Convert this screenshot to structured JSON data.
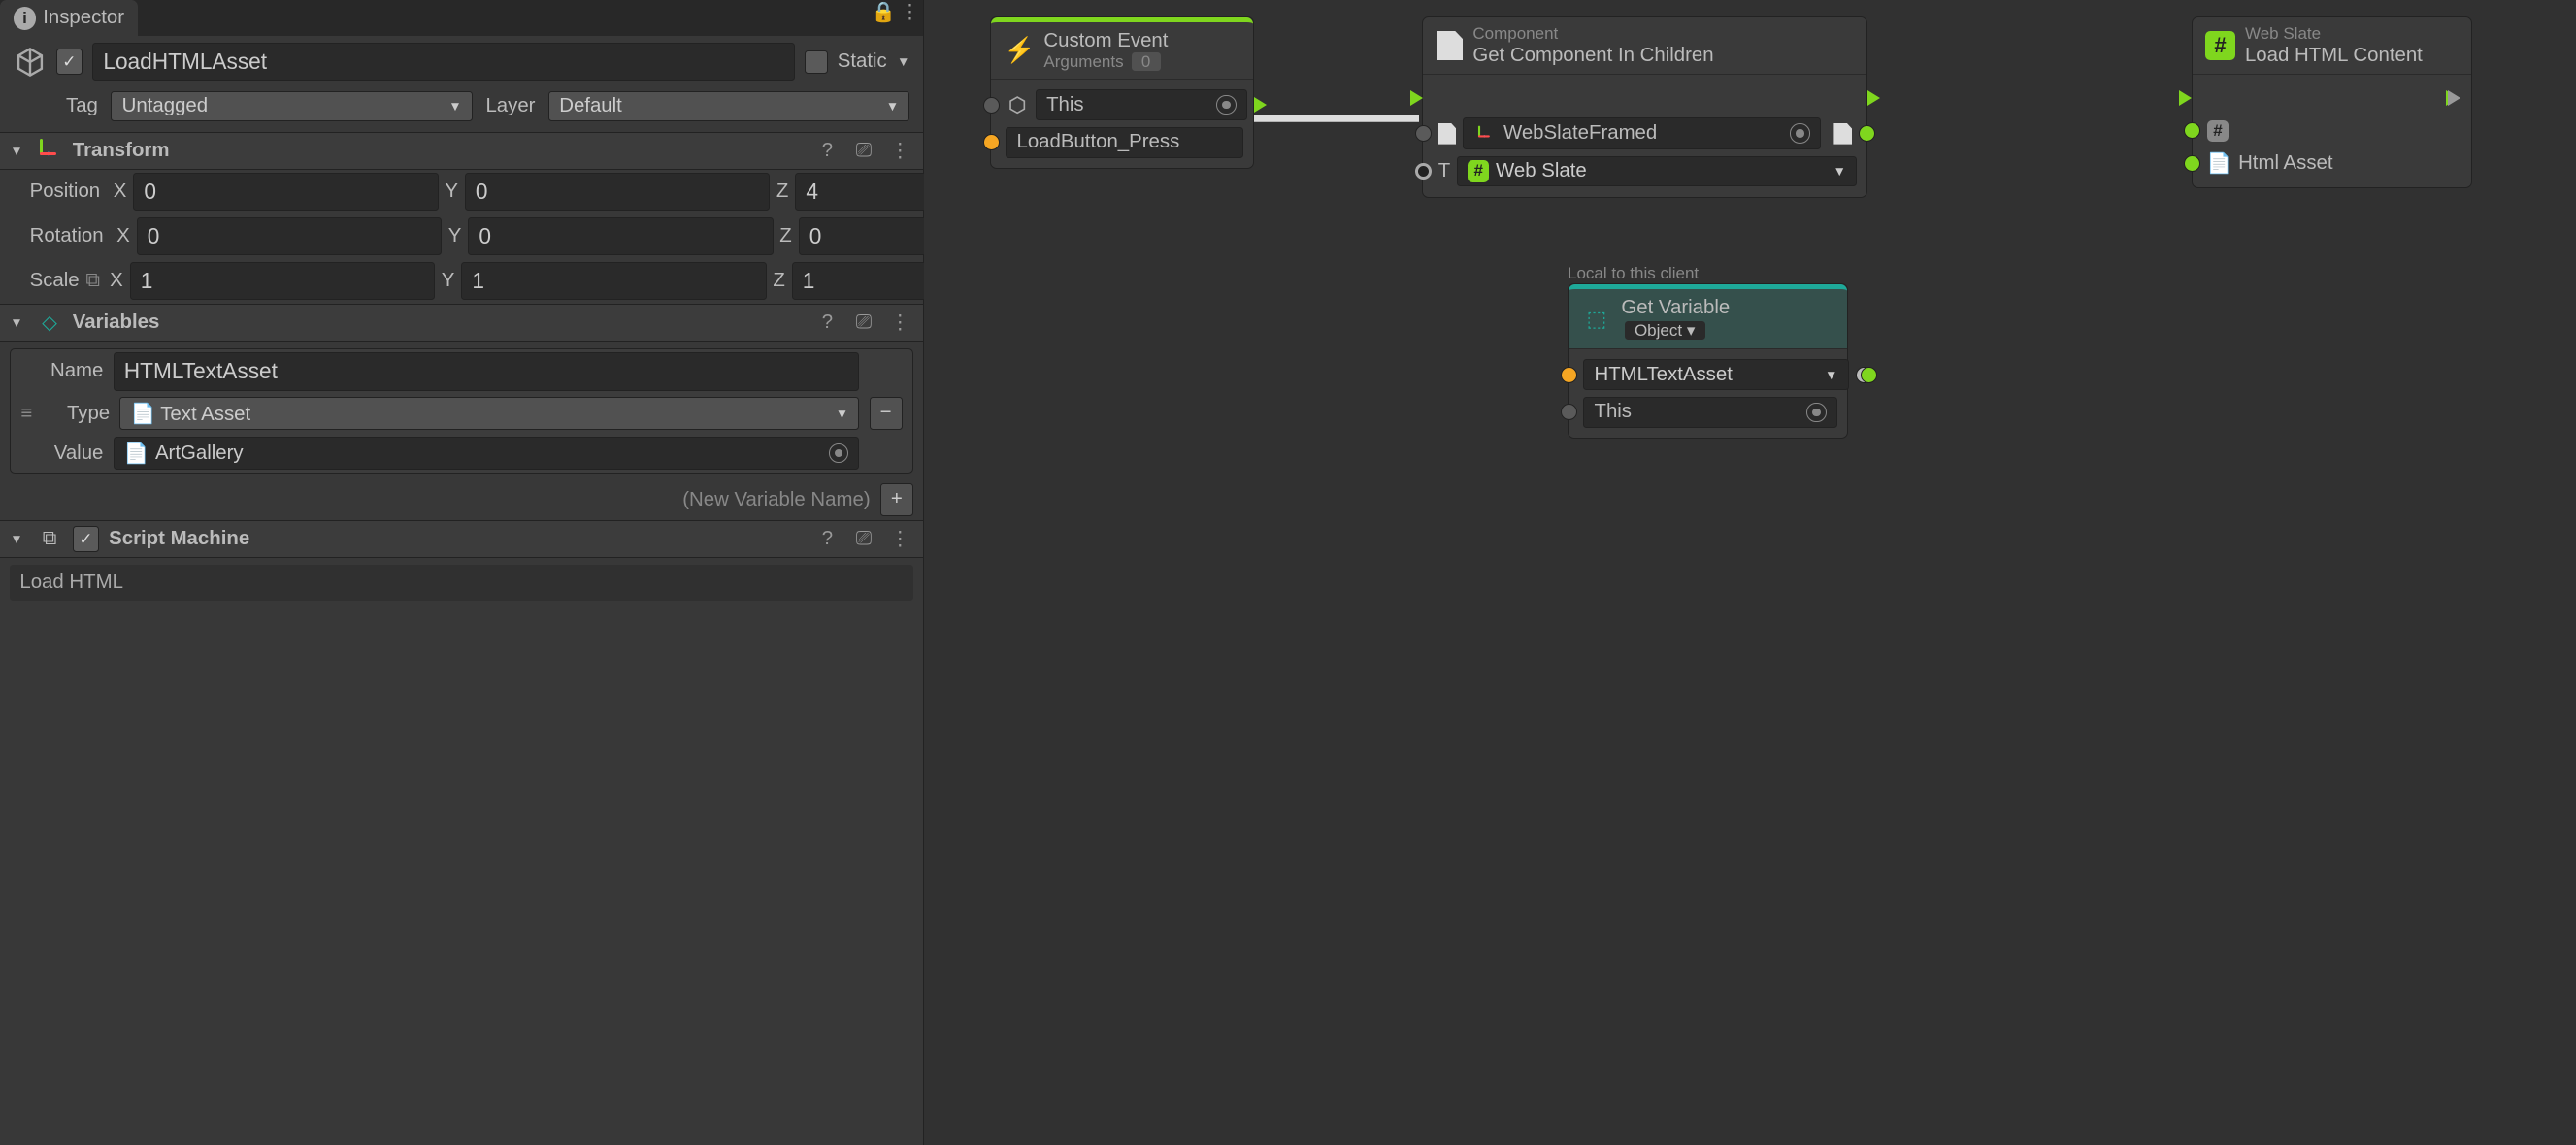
{
  "inspector": {
    "tab_title": "Inspector",
    "name": "LoadHTMLAsset",
    "static_label": "Static",
    "tag_label": "Tag",
    "tag_value": "Untagged",
    "layer_label": "Layer",
    "layer_value": "Default"
  },
  "transform": {
    "title": "Transform",
    "position_label": "Position",
    "rotation_label": "Rotation",
    "scale_label": "Scale",
    "position": {
      "x": "0",
      "y": "0",
      "z": "4"
    },
    "rotation": {
      "x": "0",
      "y": "0",
      "z": "0"
    },
    "scale": {
      "x": "1",
      "y": "1",
      "z": "1"
    }
  },
  "variables": {
    "title": "Variables",
    "name_label": "Name",
    "name_value": "HTMLTextAsset",
    "type_label": "Type",
    "type_value": "Text Asset",
    "value_label": "Value",
    "value_value": "ArtGallery",
    "new_var_hint": "(New Variable Name)"
  },
  "script_machine": {
    "title": "Script Machine",
    "graph_name": "Load HTML"
  },
  "graph": {
    "custom_event": {
      "title": "Custom Event",
      "arguments_label": "Arguments",
      "arguments_value": "0",
      "target_value": "This",
      "event_name": "LoadButton_Press"
    },
    "get_component": {
      "category": "Component",
      "title": "Get Component In Children",
      "target_value": "WebSlateFramed",
      "type_label": "T",
      "type_value": "Web Slate"
    },
    "get_variable": {
      "local_label": "Local to this client",
      "title": "Get Variable",
      "kind": "Object",
      "var_name": "HTMLTextAsset",
      "fallback": "This"
    },
    "load_html": {
      "category": "Web Slate",
      "title": "Load HTML Content",
      "param_label": "Html Asset"
    }
  }
}
